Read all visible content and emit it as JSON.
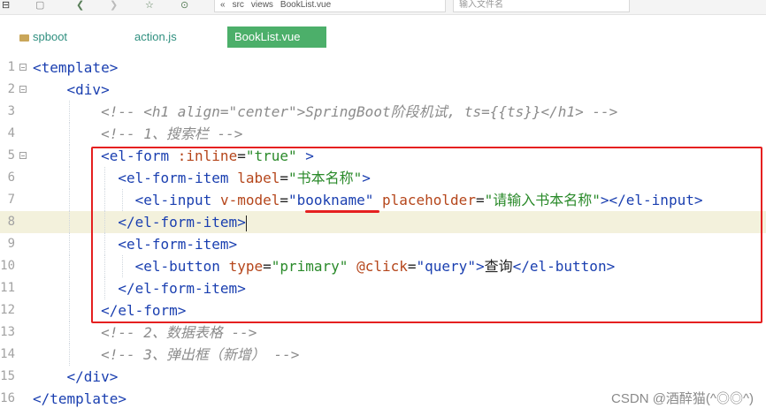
{
  "toolbar": {
    "icons": [
      "back-icon",
      "forward-icon",
      "star-icon",
      "play-icon"
    ],
    "breadcrumb": [
      "«",
      "src",
      "views",
      "BookList.vue"
    ],
    "search_placeholder": "输入文件名"
  },
  "tabs": [
    {
      "label": "spboot",
      "icon": "folder-icon",
      "active": false
    },
    {
      "label": "action.js",
      "active": false
    },
    {
      "label": "BookList.vue",
      "active": true
    }
  ],
  "editor": {
    "line_numbers": [
      "1",
      "2",
      "3",
      "4",
      "5",
      "6",
      "7",
      "8",
      "9",
      "10",
      "11",
      "12",
      "13",
      "14",
      "15",
      "16"
    ],
    "lines": {
      "l1": {
        "tag": "<template>"
      },
      "l2": {
        "tag": "<div>"
      },
      "l3": {
        "comment": "<!-- <h1 align=\"center\">SpringBoot阶段机试, ts={{ts}}</h1> -->"
      },
      "l4": {
        "comment": "<!-- 1、搜索栏 -->"
      },
      "l5": {
        "open": "<el-form",
        "attr": ":inline",
        "eq": "=",
        "val": "\"true\"",
        "close": " >"
      },
      "l6": {
        "open": "<el-form-item",
        "attr": "label",
        "eq": "=",
        "val": "\"书本名称\"",
        "close": ">"
      },
      "l7": {
        "open": "<el-input",
        "attr1": "v-model",
        "eq1": "=",
        "val1": "\"bookname\"",
        "attr2": "placeholder",
        "eq2": "=",
        "val2": "\"请输入书本名称\"",
        "close": "></el-input>"
      },
      "l8": {
        "tag": "</el-form-item>"
      },
      "l9": {
        "tag": "<el-form-item>"
      },
      "l10": {
        "open": "<el-button",
        "attr1": "type",
        "eq1": "=",
        "val1": "\"primary\"",
        "attr2": "@click",
        "eq2": "=",
        "val2": "\"query\"",
        "gt": ">",
        "text": "查询",
        "close": "</el-button>"
      },
      "l11": {
        "tag": "</el-form-item>"
      },
      "l12": {
        "tag": "</el-form>"
      },
      "l13": {
        "comment": "<!-- 2、数据表格 -->"
      },
      "l14": {
        "comment": "<!-- 3、弹出框（新增） -->"
      },
      "l15": {
        "tag": "</div>"
      },
      "l16": {
        "tag": "</template>"
      }
    }
  },
  "watermark": "CSDN @酒醉猫(^◎◎^)",
  "colors": {
    "tag": "#1a3fb0",
    "attribute": "#b5461b",
    "string": "#2a8a2a",
    "comment": "#8b8b8b",
    "active_tab": "#4caf6a",
    "highlight_box": "#e52020"
  }
}
